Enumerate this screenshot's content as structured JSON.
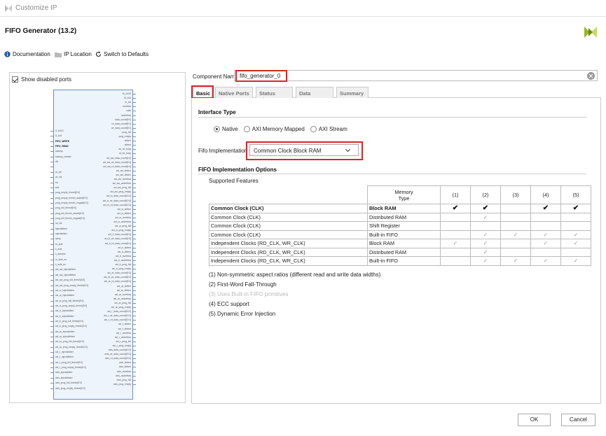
{
  "window": {
    "title": "Customize IP",
    "dialog_title": "FIFO Generator (13.2)"
  },
  "toolbar": {
    "documentation": "Documentation",
    "ip_location": "IP Location",
    "switch_defaults": "Switch to Defaults"
  },
  "left": {
    "show_disabled": "Show disabled ports"
  },
  "symbol": {
    "left_pins": [
      "S_AXIS",
      "S_AXI",
      "FIFO_WRITE",
      "FIFO_READ",
      "backup",
      "backup_marker",
      "clk",
      "",
      "rd_clk",
      "wr_clk",
      "rst",
      "srst",
      "prog_empty_thresh[9:0]",
      "prog_empty_thresh_assert[9:0]",
      "prog_empty_thresh_negate[9:0]",
      "prog_full_thresh[9:0]",
      "prog_full_thresh_assert[9:0]",
      "prog_full_thresh_negate[9:0]",
      "int_clk",
      "injectdbiterr",
      "injectsbiterr",
      "sleep",
      "m_aclk",
      "s_aclk",
      "s_aresetn",
      "m_aclk_en",
      "s_aclk_en",
      "axi_aw_injectsbiterr",
      "axi_aw_injectdbiterr",
      "axi_aw_prog_full_thresh[3:0]",
      "axi_aw_prog_empty_thresh[3:0]",
      "axi_w_injectsbiterr",
      "axi_w_injectdbiterr",
      "axi_w_prog_full_thresh[9:0]",
      "axi_w_prog_empty_thresh[9:0]",
      "axi_b_injectsbiterr",
      "axi_b_injectdbiterr",
      "axi_b_prog_full_thresh[3:0]",
      "axi_b_prog_empty_thresh[3:0]",
      "axi_ar_injectsbiterr",
      "axi_ar_injectdbiterr",
      "axi_ar_prog_full_thresh[3:0]",
      "axi_ar_prog_empty_thresh[3:0]",
      "axi_r_injectsbiterr",
      "axi_r_injectdbiterr",
      "axi_r_prog_full_thresh[9:0]",
      "axi_r_prog_empty_thresh[9:0]",
      "axis_injectsbiterr",
      "axis_injectdbiterr",
      "axis_prog_full_thresh[9:0]",
      "axis_prog_empty_thresh[9:0]"
    ],
    "left_bold": [
      2,
      3
    ],
    "right_pins": [
      "M_AXIS",
      "M_AXI",
      "m_axi",
      "overflow",
      "valid",
      "underflow",
      "data_count[9:0]",
      "rd_data_count[9:0]",
      "wr_data_count[9:0]",
      "prog_full",
      "prog_empty",
      "sbiterr",
      "dbiterr",
      "wr_rst_busy",
      "rd_rst_busy",
      "axi_aw_data_count[4:0]",
      "axi_aw_wr_data_count[4:0]",
      "axi_aw_rd_data_count[4:0]",
      "axi_aw_sbiterr",
      "axi_aw_dbiterr",
      "axi_aw_overflow",
      "axi_aw_underflow",
      "axi_aw_prog_full",
      "axi_aw_prog_empty",
      "axi_w_data_count[10:0]",
      "axi_w_wr_data_count[10:0]",
      "axi_w_rd_data_count[10:0]",
      "axi_w_sbiterr",
      "axi_w_dbiterr",
      "axi_w_overflow",
      "axi_w_underflow",
      "axi_w_prog_full",
      "axi_w_prog_empty",
      "axi_b_data_count[4:0]",
      "axi_b_wr_data_count[4:0]",
      "axi_b_rd_data_count[4:0]",
      "axi_b_sbiterr",
      "axi_b_dbiterr",
      "axi_b_overflow",
      "axi_b_underflow",
      "axi_b_prog_full",
      "axi_b_prog_empty",
      "axi_ar_data_count[4:0]",
      "axi_ar_wr_data_count[4:0]",
      "axi_ar_rd_data_count[4:0]",
      "axi_ar_sbiterr",
      "axi_ar_dbiterr",
      "axi_ar_overflow",
      "axi_ar_underflow",
      "axi_ar_prog_full",
      "axi_ar_prog_empty",
      "axi_r_data_count[10:0]",
      "axi_r_wr_data_count[10:0]",
      "axi_r_rd_data_count[10:0]",
      "axi_r_sbiterr",
      "axi_r_dbiterr",
      "axi_r_overflow",
      "axi_r_underflow",
      "axi_r_prog_full",
      "axi_r_prog_empty",
      "axis_data_count[10:0]",
      "axis_wr_data_count[10:0]",
      "axis_rd_data_count[10:0]",
      "axis_sbiterr",
      "axis_dbiterr",
      "axis_overflow",
      "axis_underflow",
      "axis_prog_full",
      "axis_prog_empty"
    ]
  },
  "component": {
    "label": "Component Name",
    "value": "fifo_generator_0"
  },
  "tabs": [
    "Basic",
    "Native Ports",
    "Status Flags",
    "Data Counts",
    "Summary"
  ],
  "interface": {
    "title": "Interface Type",
    "options": [
      "Native",
      "AXI Memory Mapped",
      "AXI Stream"
    ],
    "selected": "Native"
  },
  "fifo_impl": {
    "label": "Fifo Implementation",
    "value": "Common Clock Block RAM"
  },
  "options": {
    "title": "FIFO Implementation Options",
    "supported": "Supported Features"
  },
  "table": {
    "header_memory": "Memory",
    "header_type": "Type",
    "cols": [
      "(1)",
      "(2)",
      "(3)",
      "(4)",
      "(5)"
    ],
    "rows": [
      {
        "clock": "Common Clock (CLK)",
        "mem": "Block RAM",
        "checks": [
          1,
          1,
          0,
          1,
          1
        ],
        "bold": true
      },
      {
        "clock": "Common Clock (CLK)",
        "mem": "Distributed RAM",
        "checks": [
          0,
          1,
          0,
          0,
          0
        ]
      },
      {
        "clock": "Common Clock (CLK)",
        "mem": "Shift Register",
        "checks": [
          0,
          0,
          0,
          0,
          0
        ]
      },
      {
        "clock": "Common Clock (CLK)",
        "mem": "Built-in FIFO",
        "checks": [
          0,
          1,
          1,
          1,
          1
        ]
      },
      {
        "clock": "Independent Clocks (RD_CLK, WR_CLK)",
        "mem": "Block RAM",
        "checks": [
          1,
          1,
          0,
          1,
          1
        ]
      },
      {
        "clock": "Independent Clocks (RD_CLK, WR_CLK)",
        "mem": "Distributed RAM",
        "checks": [
          0,
          1,
          0,
          0,
          0
        ]
      },
      {
        "clock": "Independent Clocks (RD_CLK, WR_CLK)",
        "mem": "Built-in FIFO",
        "checks": [
          0,
          1,
          1,
          1,
          1
        ]
      }
    ]
  },
  "notes": [
    "(1) Non-symmetric aspect ratios (different read and write data widths)",
    "(2) First-Word Fall-Through",
    "(3) Uses Built-in FIFO primitives",
    "(4) ECC support",
    "(5) Dynamic Error Injection"
  ],
  "buttons": {
    "ok": "OK",
    "cancel": "Cancel"
  },
  "colors": {
    "highlight": "#d9252a",
    "symbol_border": "#6a8fc0",
    "logo": "#9ab526"
  }
}
